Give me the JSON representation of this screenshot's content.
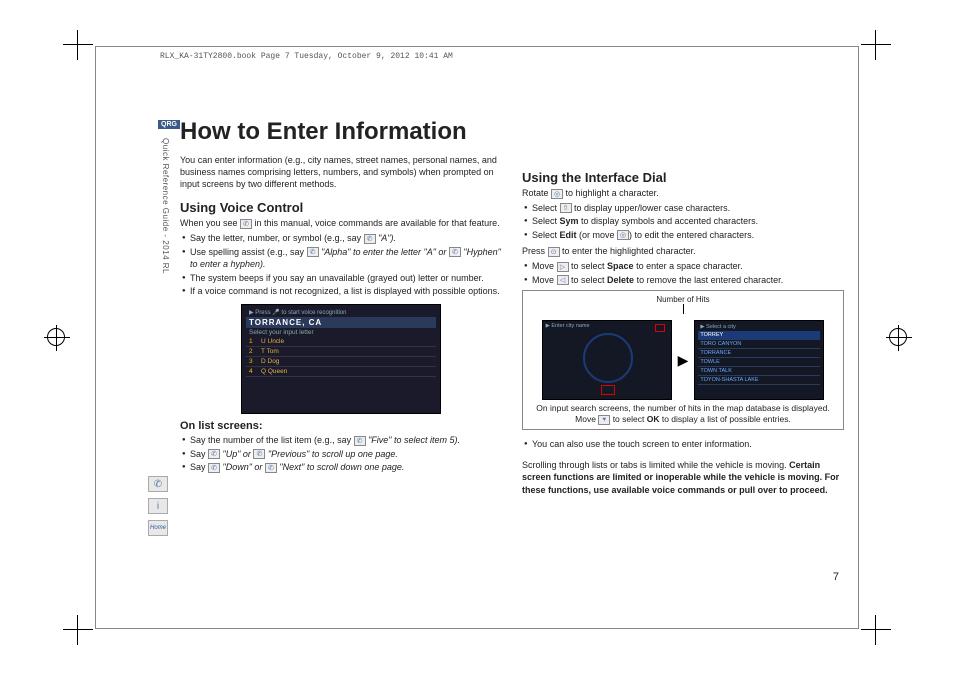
{
  "meta": {
    "header": "RLX_KA-31TY2800.book  Page 7  Tuesday, October 9, 2012  10:41 AM",
    "qrg": "QRG",
    "sidebar": "Quick Reference Guide - 2014 RL",
    "page_number": "7"
  },
  "title": "How to Enter Information",
  "intro": "You can enter information (e.g., city names, street names, personal names, and business names comprising letters, numbers, and symbols) when prompted on input screens by two different methods.",
  "left": {
    "h_voice": "Using Voice Control",
    "voice_intro_a": "When you see ",
    "voice_intro_b": " in this manual, voice commands are available for that feature.",
    "b1a": "Say the letter, number, or symbol (e.g., say ",
    "b1b": " \"A\").",
    "b2a": "Use spelling assist (e.g., say ",
    "b2b": " \"Alpha\" to enter the letter \"A\" or ",
    "b2c": " \"Hyphen\" to enter a hyphen).",
    "b3": "The system beeps if you say an unavailable (grayed out) letter or number.",
    "b4": "If a voice command is not recognized, a list is displayed with possible options.",
    "shot_title": "TORRANCE, CA",
    "shot_sub": "Select your input letter",
    "rows": [
      {
        "n": "1",
        "t": "U Uncle"
      },
      {
        "n": "2",
        "t": "T Tom"
      },
      {
        "n": "3",
        "t": "D Dog"
      },
      {
        "n": "4",
        "t": "Q Queen"
      }
    ],
    "h_list": "On list screens:",
    "l1a": "Say the number of the list item (e.g., say ",
    "l1b": " \"Five\" to select item 5).",
    "l2a": "Say ",
    "l2b": " \"Up\" or ",
    "l2c": " \"Previous\" to scroll up one page.",
    "l3a": "Say ",
    "l3b": " \"Down\" or ",
    "l3c": " \"Next\" to scroll down one page."
  },
  "right": {
    "h_dial": "Using the Interface Dial",
    "rotate_a": "Rotate ",
    "rotate_b": " to highlight a character.",
    "d1a": "Select ",
    "d1b": " to display upper/lower case characters.",
    "d2": "Select Sym to display symbols and accented characters.",
    "d3a": "Select Edit (or move ",
    "d3b": ") to edit the entered characters.",
    "press_a": "Press ",
    "press_b": " to enter the highlighted character.",
    "m1a": "Move ",
    "m1b": " to select Space to enter a space character.",
    "m2a": "Move ",
    "m2b": " to select Delete to remove the last entered character.",
    "hits_label": "Number of Hits",
    "right_list": [
      "TORREY",
      "TORO CANYON",
      "TORRANCE",
      "TOWLE",
      "TOWN TALK",
      "TOYON-SHASTA LAKE"
    ],
    "info_box": "On input search screens, the number of hits in the map database is displayed. Move ⯆ to select OK to display a list of possible entries.",
    "touch": "You can also use the touch screen to enter information.",
    "scroll": "Scrolling through lists or tabs is limited while the vehicle is moving.",
    "warn": "Certain screen functions are limited or inoperable while the vehicle is moving. For these functions, use available voice commands or pull over to proceed."
  },
  "icons": {
    "talk": "✆",
    "dial": "◎",
    "press": "⊙",
    "right": "▷",
    "left": "◁",
    "shift": "⇧",
    "info": "i",
    "home": "Home"
  }
}
